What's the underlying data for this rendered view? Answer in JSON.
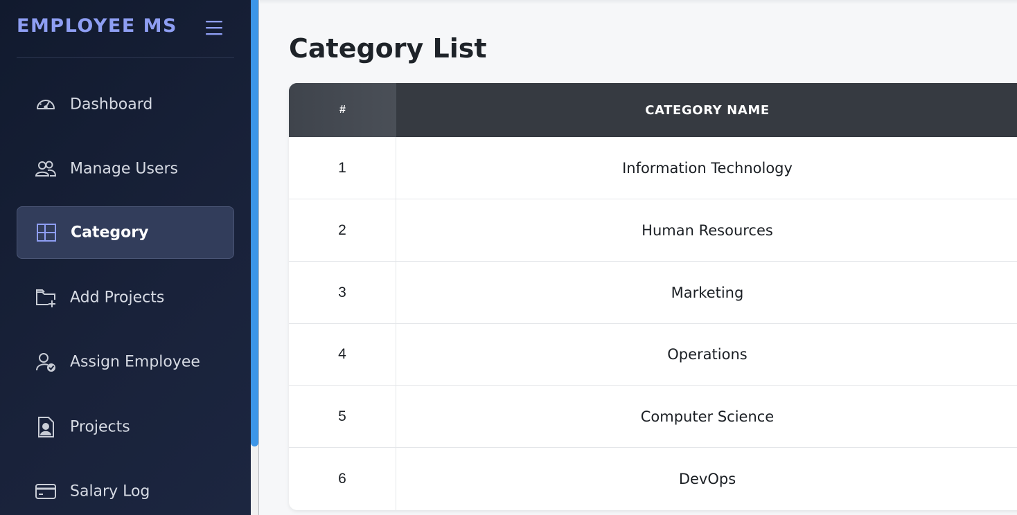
{
  "sidebar": {
    "brand": "EMPLOYEE MS",
    "items": [
      {
        "label": "Dashboard",
        "icon": "gauge-icon"
      },
      {
        "label": "Manage Users",
        "icon": "users-icon"
      },
      {
        "label": "Category",
        "icon": "layout-icon",
        "active": true
      },
      {
        "label": "Add Projects",
        "icon": "folder-plus-icon"
      },
      {
        "label": "Assign Employee",
        "icon": "user-check-icon"
      },
      {
        "label": "Projects",
        "icon": "file-person-icon"
      },
      {
        "label": "Salary Log",
        "icon": "credit-card-icon"
      }
    ]
  },
  "main": {
    "title": "Category List",
    "table": {
      "headers": [
        "#",
        "CATEGORY NAME"
      ],
      "rows": [
        [
          "1",
          "Information Technology"
        ],
        [
          "2",
          "Human Resources"
        ],
        [
          "3",
          "Marketing"
        ],
        [
          "4",
          "Operations"
        ],
        [
          "5",
          "Computer Science"
        ],
        [
          "6",
          "DevOps"
        ]
      ]
    }
  },
  "colors": {
    "brand": "#8e9ef3",
    "sidebar_bg": "#141c30",
    "active_item_bg": "#323d5b",
    "table_header_bg": "#363a41",
    "scrollbar_thumb": "#3c96e8"
  }
}
